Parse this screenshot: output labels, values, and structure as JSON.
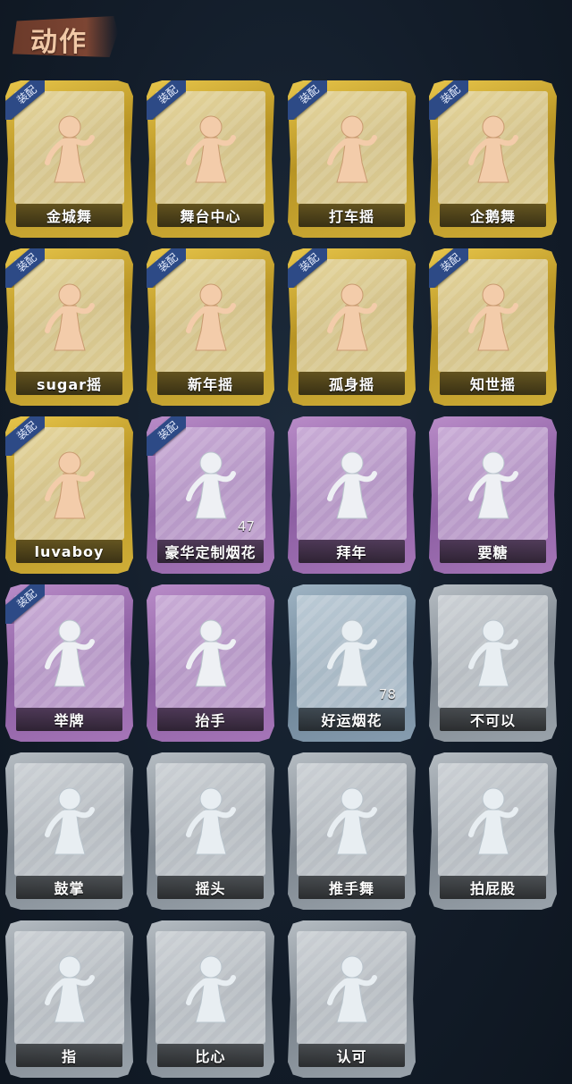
{
  "header": {
    "title": "动作"
  },
  "badge_text": "装配",
  "cards": [
    {
      "label": "金城舞",
      "theme": "gold",
      "equipped": true
    },
    {
      "label": "舞台中心",
      "theme": "gold",
      "equipped": true
    },
    {
      "label": "打车摇",
      "theme": "gold",
      "equipped": true
    },
    {
      "label": "企鹅舞",
      "theme": "gold",
      "equipped": true
    },
    {
      "label": "sugar摇",
      "theme": "gold",
      "equipped": true
    },
    {
      "label": "新年摇",
      "theme": "gold",
      "equipped": true
    },
    {
      "label": "孤身摇",
      "theme": "gold",
      "equipped": true
    },
    {
      "label": "知世摇",
      "theme": "gold",
      "equipped": true
    },
    {
      "label": "luvaboy",
      "theme": "gold",
      "equipped": true
    },
    {
      "label": "豪华定制烟花",
      "theme": "purple",
      "equipped": true,
      "count": "47"
    },
    {
      "label": "拜年",
      "theme": "purple",
      "equipped": false
    },
    {
      "label": "要糖",
      "theme": "purple",
      "equipped": false
    },
    {
      "label": "举牌",
      "theme": "purple",
      "equipped": true
    },
    {
      "label": "抬手",
      "theme": "purple",
      "equipped": false
    },
    {
      "label": "好运烟花",
      "theme": "blue",
      "equipped": false,
      "count": "78"
    },
    {
      "label": "不可以",
      "theme": "grey",
      "equipped": false
    },
    {
      "label": "鼓掌",
      "theme": "grey",
      "equipped": false
    },
    {
      "label": "摇头",
      "theme": "grey",
      "equipped": false
    },
    {
      "label": "推手舞",
      "theme": "grey",
      "equipped": false
    },
    {
      "label": "拍屁股",
      "theme": "grey",
      "equipped": false
    },
    {
      "label": "指",
      "theme": "grey",
      "equipped": false
    },
    {
      "label": "比心",
      "theme": "grey",
      "equipped": false
    },
    {
      "label": "认可",
      "theme": "grey",
      "equipped": false
    }
  ]
}
